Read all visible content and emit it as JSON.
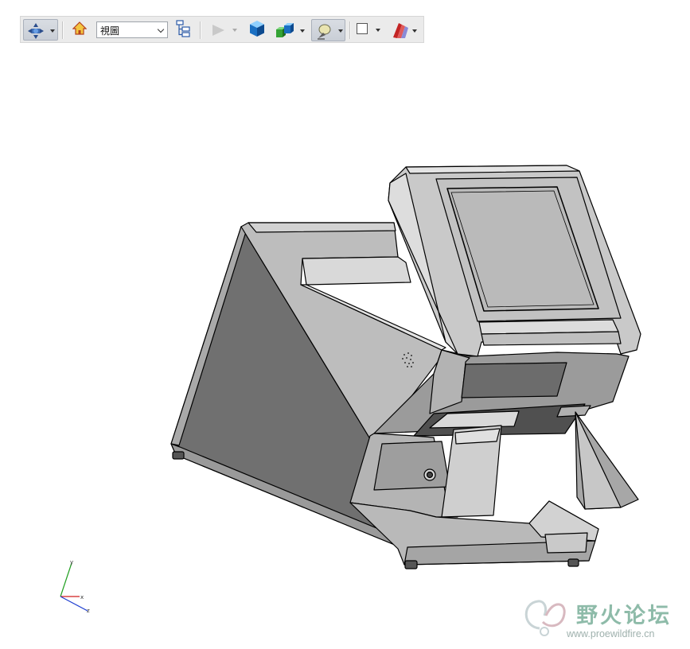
{
  "toolbar": {
    "icons": [
      "orient-icon",
      "home-icon",
      "view-list-icon",
      "play-icon",
      "shaded-cube-icon",
      "display-style-icon",
      "lighting-icon",
      "frame-icon",
      "appearance-icon"
    ],
    "view_select": {
      "value": "視圖"
    }
  },
  "triad": {
    "x": "x",
    "y": "y",
    "z": "z",
    "colors": {
      "x": "#d11f1f",
      "y": "#22a022",
      "z": "#1f3fd1"
    }
  },
  "watermark": {
    "brand": "野火论坛",
    "url": "www.proewildfire.cn"
  },
  "colors": {
    "toolbar_bg": "#ebebeb",
    "model_dark": "#6f6f6f",
    "model_light": "#c8c8c8",
    "edge": "#000000"
  }
}
